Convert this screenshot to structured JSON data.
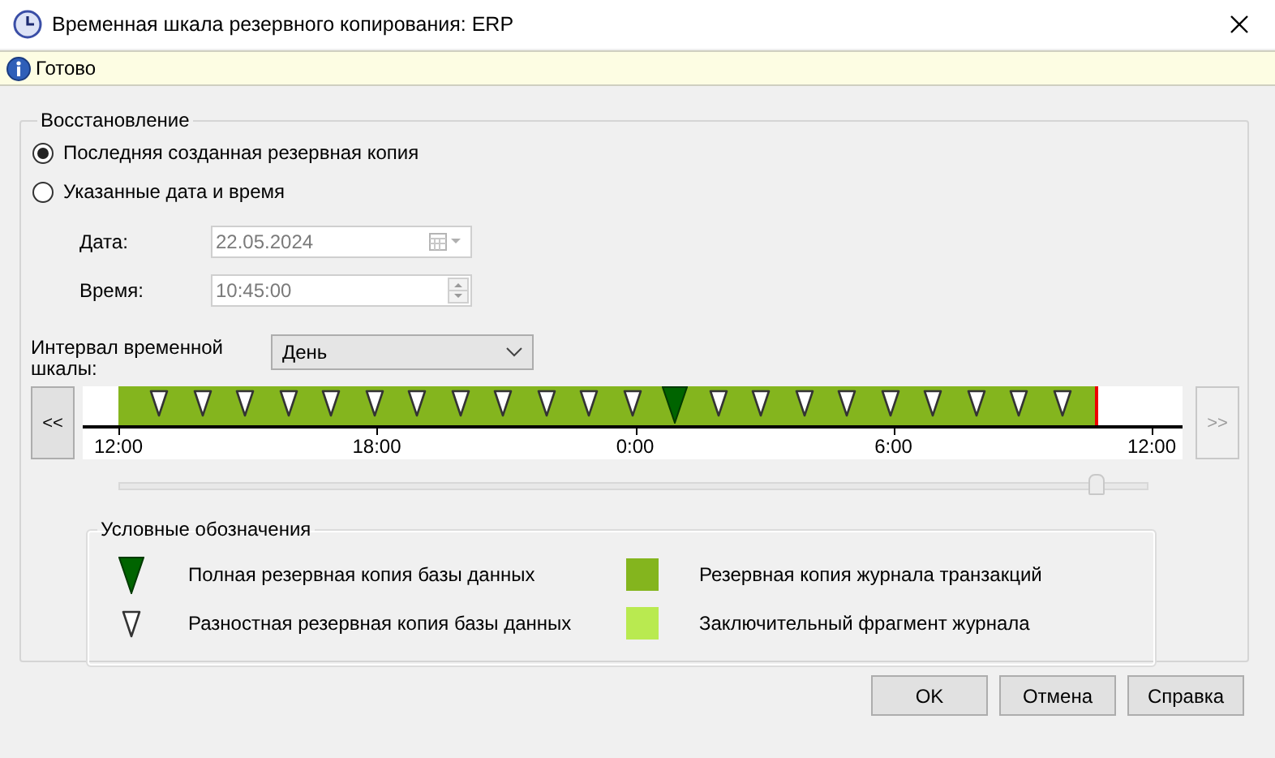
{
  "window": {
    "title": "Временная шкала резервного копирования: ERP"
  },
  "status": {
    "text": "Готово"
  },
  "restore": {
    "title": "Восстановление",
    "options": [
      {
        "label": "Последняя созданная резервная копия",
        "selected": true
      },
      {
        "label": "Указанные дата и время",
        "selected": false
      }
    ],
    "date": {
      "label": "Дата:",
      "value": "22.05.2024",
      "disabled": true
    },
    "time": {
      "label": "Время:",
      "value": "10:45:00",
      "disabled": true
    },
    "interval": {
      "label": "Интервал временной шкалы:",
      "value": "День"
    },
    "timeline": {
      "back": {
        "label": "<<",
        "disabled": false
      },
      "forward": {
        "label": ">>",
        "disabled": true
      },
      "markers": [
        {
          "kind": "diff"
        },
        {
          "kind": "diff"
        },
        {
          "kind": "diff"
        },
        {
          "kind": "diff"
        },
        {
          "kind": "diff"
        },
        {
          "kind": "diff"
        },
        {
          "kind": "diff"
        },
        {
          "kind": "diff"
        },
        {
          "kind": "diff"
        },
        {
          "kind": "diff"
        },
        {
          "kind": "diff"
        },
        {
          "kind": "diff"
        },
        {
          "kind": "full"
        },
        {
          "kind": "diff"
        },
        {
          "kind": "diff"
        },
        {
          "kind": "diff"
        },
        {
          "kind": "diff"
        },
        {
          "kind": "diff"
        },
        {
          "kind": "diff"
        },
        {
          "kind": "diff"
        },
        {
          "kind": "diff"
        },
        {
          "kind": "diff"
        }
      ],
      "axis_labels": [
        "12:00",
        "18:00",
        "0:00",
        "6:00",
        "12:00"
      ],
      "slider": {
        "level": 0.95
      }
    },
    "legend": {
      "title": "Условные обозначения",
      "items": [
        {
          "kind": "full",
          "label": "Полная резервная копия базы данных"
        },
        {
          "kind": "log",
          "label": "Резервная копия журнала транзакций",
          "color": "#84b51e"
        },
        {
          "kind": "diff",
          "label": "Разностная резервная копия базы данных"
        },
        {
          "kind": "tail",
          "label": "Заключительный фрагмент журнала",
          "color": "#b9ea50"
        }
      ]
    }
  },
  "buttons": [
    {
      "label": "OK"
    },
    {
      "label": "Отмена"
    },
    {
      "label": "Справка"
    }
  ]
}
